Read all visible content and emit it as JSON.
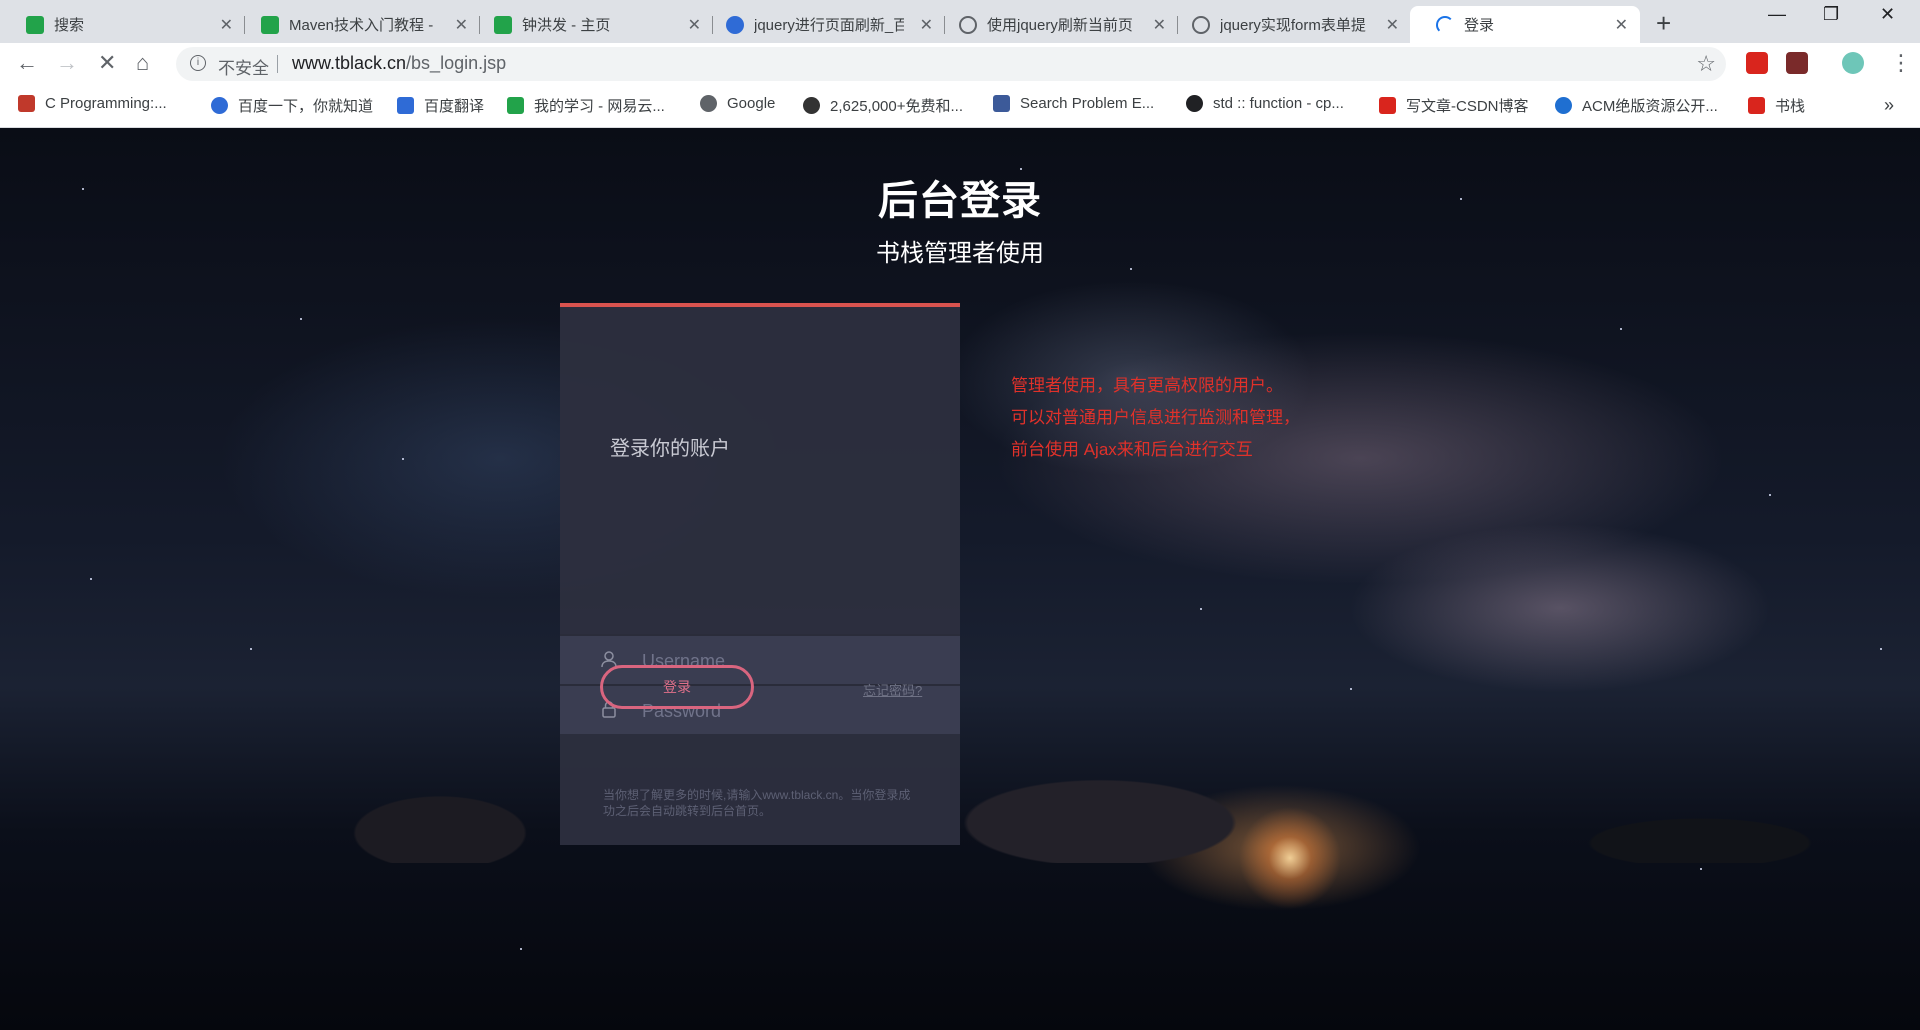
{
  "browser": {
    "tabs": [
      {
        "label": "搜索",
        "close": "✕",
        "icon": "green-book-icon",
        "active": false
      },
      {
        "label": "Maven技术入门教程 -",
        "close": "✕",
        "icon": "green-book-icon",
        "active": false
      },
      {
        "label": "钟洪发 - 主页",
        "close": "✕",
        "icon": "green-book-icon",
        "active": false
      },
      {
        "label": "jquery进行页面刷新_百",
        "close": "✕",
        "icon": "baidu-paw-icon",
        "active": false
      },
      {
        "label": "使用jquery刷新当前页",
        "close": "✕",
        "icon": "loading-icon",
        "active": false
      },
      {
        "label": "jquery实现form表单提",
        "close": "✕",
        "icon": "loading-icon",
        "active": false
      },
      {
        "label": "登录",
        "close": "✕",
        "icon": "loading-spinner-icon",
        "active": true
      }
    ],
    "new_tab": "+",
    "window_controls": {
      "minimize": "—",
      "restore": "❐",
      "close": "✕"
    },
    "nav": {
      "back": "←",
      "forward": "→",
      "stop": "✕",
      "home": "⌂"
    },
    "omnibox": {
      "info": "i",
      "security": "不安全",
      "url_host": "www.tblack.cn",
      "url_path": "/bs_login.jsp",
      "star": "☆"
    },
    "menu": "⋮",
    "bookmarks": [
      {
        "label": "C Programming:...",
        "icon": "c-programming-icon",
        "color": "#c0392b"
      },
      {
        "label": "百度一下，你就知道",
        "icon": "baidu-paw-icon",
        "color": "#2f6bd6"
      },
      {
        "label": "百度翻译",
        "icon": "baidu-translate-icon",
        "color": "#2f6bd6"
      },
      {
        "label": "我的学习 - 网易云...",
        "icon": "green-book-icon",
        "color": "#22a34a"
      },
      {
        "label": "Google",
        "icon": "globe-icon",
        "color": "#5f6368"
      },
      {
        "label": "2,625,000+免费和...",
        "icon": "stack-icon",
        "color": "#333333"
      },
      {
        "label": "Search Problem E...",
        "icon": "poj-icon",
        "color": "#3c5a99"
      },
      {
        "label": "std :: function - cp...",
        "icon": "cpp-reference-icon",
        "color": "#202124"
      },
      {
        "label": "写文章-CSDN博客",
        "icon": "csdn-icon",
        "color": "#d9251d"
      },
      {
        "label": "ACM绝版资源公开...",
        "icon": "edge-icon",
        "color": "#1f6fd1"
      },
      {
        "label": "书栈",
        "icon": "shuzhan-icon",
        "color": "#d9251d"
      }
    ],
    "bookmarks_overflow": "»"
  },
  "page": {
    "title": "后台登录",
    "subtitle": "书栈管理者使用",
    "card": {
      "heading": "登录你的账户",
      "username_placeholder": "Username",
      "password_placeholder": "Password",
      "login_button": "登录",
      "forgot_link": "忘记密码?",
      "note": "当你想了解更多的时候,请输入www.tblack.cn。当你登录成功之后会自动跳转到后台首页。"
    },
    "side_notes": [
      "管理者使用，具有更高权限的用户。",
      "可以对普通用户信息进行监测和管理，",
      "前台使用 Ajax来和后台进行交互"
    ]
  }
}
